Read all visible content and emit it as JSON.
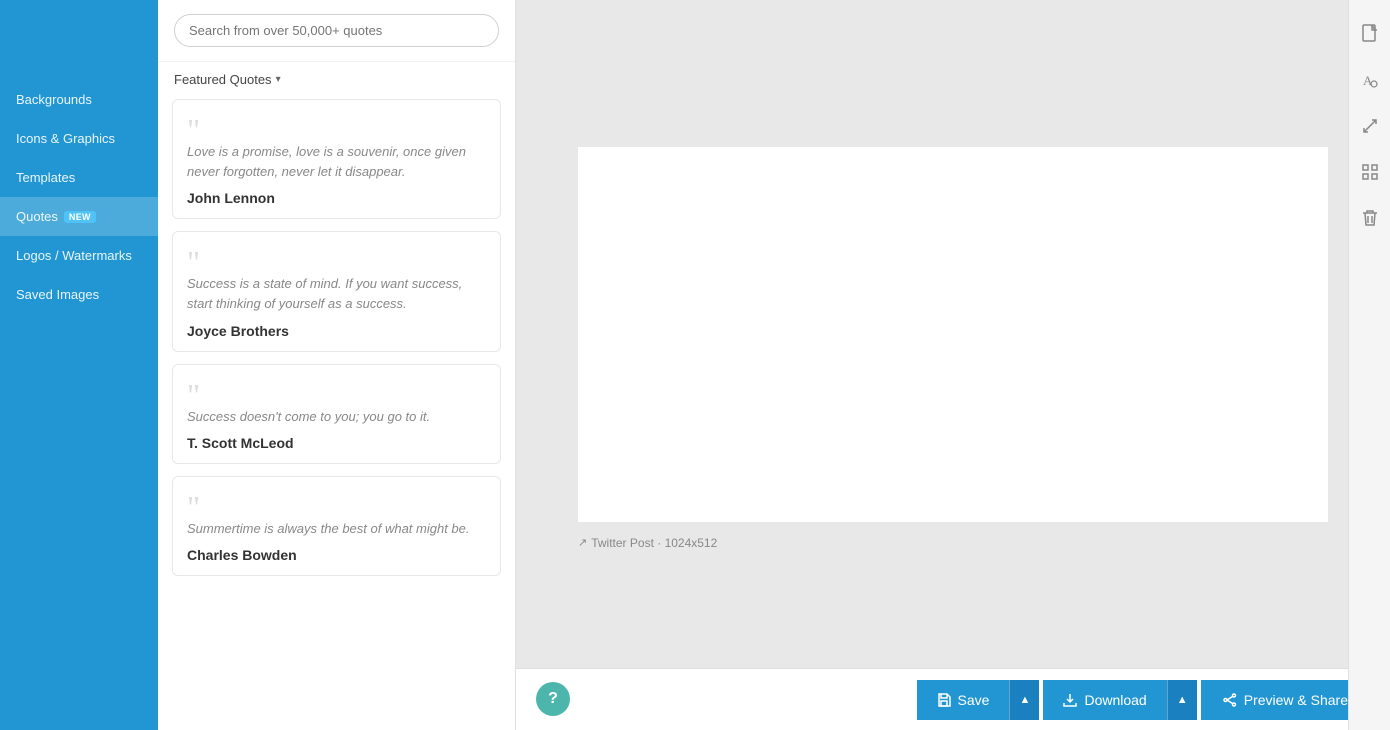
{
  "sidebar": {
    "items": [
      {
        "id": "backgrounds",
        "label": "Backgrounds",
        "active": false
      },
      {
        "id": "icons-graphics",
        "label": "Icons & Graphics",
        "active": false
      },
      {
        "id": "templates",
        "label": "Templates",
        "active": false
      },
      {
        "id": "quotes",
        "label": "Quotes",
        "badge": "NEW",
        "active": true
      },
      {
        "id": "logos-watermarks",
        "label": "Logos / Watermarks",
        "active": false
      },
      {
        "id": "saved-images",
        "label": "Saved Images",
        "active": false
      }
    ]
  },
  "search": {
    "placeholder": "Search from over 50,000+ quotes"
  },
  "featured": {
    "section_label": "Featured Quotes",
    "chevron": "▾"
  },
  "quotes": [
    {
      "id": 1,
      "text": "Love is a promise, love is a souvenir, once given never forgotten, never let it disappear.",
      "author": "John Lennon"
    },
    {
      "id": 2,
      "text": "Success is a state of mind. If you want success, start thinking of yourself as a success.",
      "author": "Joyce Brothers"
    },
    {
      "id": 3,
      "text": "Success doesn't come to you; you go to it.",
      "author": "T. Scott McLeod"
    },
    {
      "id": 4,
      "text": "Summertime is always the best of what might be.",
      "author": "Charles Bowden"
    }
  ],
  "canvas": {
    "label": "Twitter Post · 1024x512"
  },
  "toolbar": {
    "tools": [
      {
        "id": "page",
        "icon": "☐",
        "label": "page-icon"
      },
      {
        "id": "text",
        "icon": "Aₒ",
        "label": "text-icon"
      },
      {
        "id": "resize",
        "icon": "↗",
        "label": "resize-icon"
      },
      {
        "id": "grid",
        "icon": "⊞",
        "label": "grid-icon"
      },
      {
        "id": "delete",
        "icon": "🗑",
        "label": "delete-icon"
      }
    ]
  },
  "bottom_bar": {
    "save_label": "Save",
    "download_label": "Download",
    "preview_label": "Preview & Share",
    "help_icon": "?"
  }
}
